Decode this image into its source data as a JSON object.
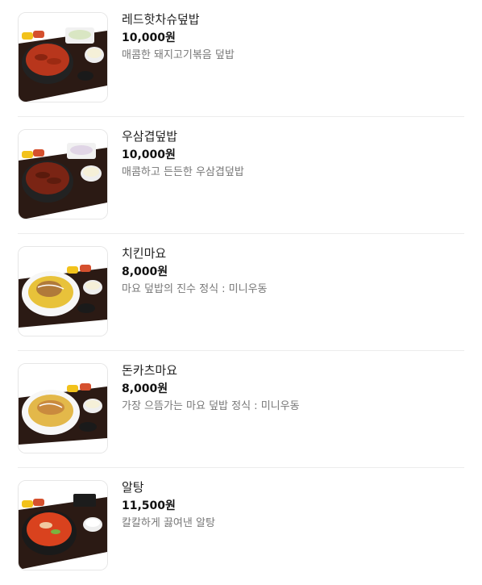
{
  "menu": {
    "items": [
      {
        "name": "레드핫차슈덮밥",
        "price": "10,000원",
        "description": "매콤한 돼지고기볶음 덮밥",
        "image_icon": "spicy-pork-rice-bowl-photo",
        "bowl_color": "#b8361c"
      },
      {
        "name": "우삼겹덮밥",
        "price": "10,000원",
        "description": "매콤하고 든든한 우삼겹덮밥",
        "image_icon": "beef-brisket-rice-bowl-photo",
        "bowl_color": "#7a2414"
      },
      {
        "name": "치킨마요",
        "price": "8,000원",
        "description": "마요 덮밥의 진수 정식 : 미니우동",
        "image_icon": "chicken-mayo-rice-bowl-photo",
        "bowl_color": "#e8c23a"
      },
      {
        "name": "돈카츠마요",
        "price": "8,000원",
        "description": "가장 으뜸가는 마요 덮밥 정식 : 미니우동",
        "image_icon": "pork-cutlet-mayo-rice-bowl-photo",
        "bowl_color": "#e3b84a"
      },
      {
        "name": "알탕",
        "price": "11,500원",
        "description": "칼칼하게 끓여낸 알탕",
        "image_icon": "pollock-roe-stew-photo",
        "bowl_color": "#d9421e"
      }
    ]
  }
}
